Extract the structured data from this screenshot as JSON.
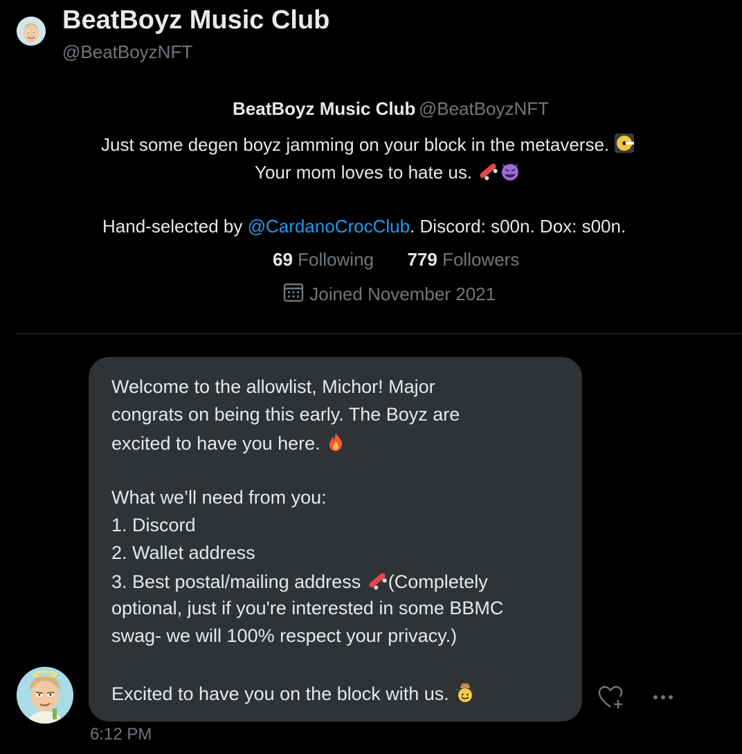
{
  "header": {
    "name": "BeatBoyz Music Club",
    "handle": "@BeatBoyzNFT"
  },
  "profile": {
    "name": "BeatBoyz Music Club",
    "handle": "@BeatBoyzNFT",
    "bio_line1": "Just some degen boyz jamming on your block in the metaverse.",
    "bio_line2": "Your mom loves to hate us.",
    "bio_line3_prefix": "Hand-selected by ",
    "bio_line3_mention": "@CardanoCrocClub",
    "bio_line3_suffix": ". Discord: s00n. Dox: s00n.",
    "following_count": "69",
    "following_label": "Following",
    "followers_count": "779",
    "followers_label": "Followers",
    "joined": "Joined November 2021"
  },
  "message": {
    "lines": [
      "Welcome to the allowlist, Michor! Major",
      "congrats on being this early. The Boyz are",
      "excited to have you here.",
      "",
      "What we’ll need from you:",
      "1. Discord",
      "2. Wallet address",
      "3. Best postal/mailing address ",
      "optional, just if you're interested in some BBMC",
      "swag- we will 100% respect your privacy.)",
      "",
      "Excited to have you on the block with us."
    ],
    "line8_suffix": "(Completely",
    "timestamp": "6:12 PM"
  },
  "icons": {
    "header_avatar": "avatar-icon",
    "calendar": "calendar-icon",
    "react": "heart-plus-icon",
    "more": "more-dots-icon"
  },
  "colors": {
    "background": "#000000",
    "bubble": "#2f3336",
    "link": "#1d9bf0",
    "muted": "#71767b",
    "text": "#e7e9ea"
  }
}
